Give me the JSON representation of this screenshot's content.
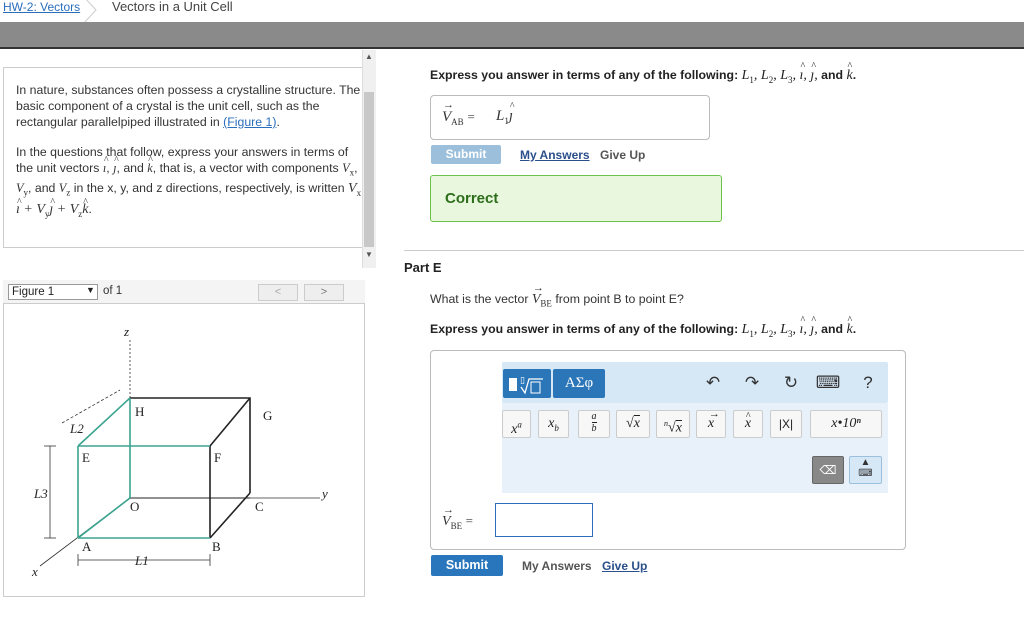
{
  "breadcrumb": {
    "link": "HW-2: Vectors",
    "current": "Vectors in a Unit Cell"
  },
  "intro": {
    "p1_text": "In nature, substances often possess a crystalline structure. The basic component of a crystal is the unit cell, such as the rectangular parallelpiped illustrated in",
    "p1_link": "(Figure 1)",
    "p1_end": ".",
    "p2_a": "In the questions that follow, express your answers in terms of the unit vectors",
    "p2_b": ", that is, a vector with components",
    "p2_c": "in the x, y, and z directions, respectively, is written"
  },
  "figure": {
    "select_value": "Figure 1",
    "of_text": "of 1",
    "prev_label": "<",
    "next_label": ">",
    "labels": {
      "z": "z",
      "y": "y",
      "x": "x",
      "H": "H",
      "G": "G",
      "E": "E",
      "F": "F",
      "O": "O",
      "C": "C",
      "A": "A",
      "B": "B",
      "L1": "L1",
      "L2": "L2",
      "L3": "L3"
    }
  },
  "partD": {
    "instruction": "Express you answer in terms of any of the following:",
    "answer_lhs": "V",
    "answer_lhs_sub": "AB",
    "answer_rhs": "L",
    "answer_rhs_sub": "1",
    "submit_label": "Submit",
    "myanswers_label": "My Answers",
    "giveup_label": "Give Up",
    "feedback": "Correct"
  },
  "partE": {
    "title": "Part E",
    "question": "What is the vector",
    "question_sub": "BE",
    "question_end": "from point B to point E?",
    "instruction": "Express you answer in terms of any of the following:",
    "answer_lhs": "V",
    "answer_lhs_sub": "BE",
    "answer_value": "",
    "submit_label": "Submit",
    "myanswers_label": "My Answers",
    "giveup_label": "Give Up"
  },
  "editor": {
    "symbols_label": "ΑΣφ",
    "keys": {
      "sci": "x•10ⁿ",
      "abs": "|X|"
    }
  },
  "colors": {
    "accent": "#2a76bd",
    "correct_bg": "#e8f7dd",
    "correct_border": "#6cc24a",
    "cube_teal": "#3aa38f"
  }
}
